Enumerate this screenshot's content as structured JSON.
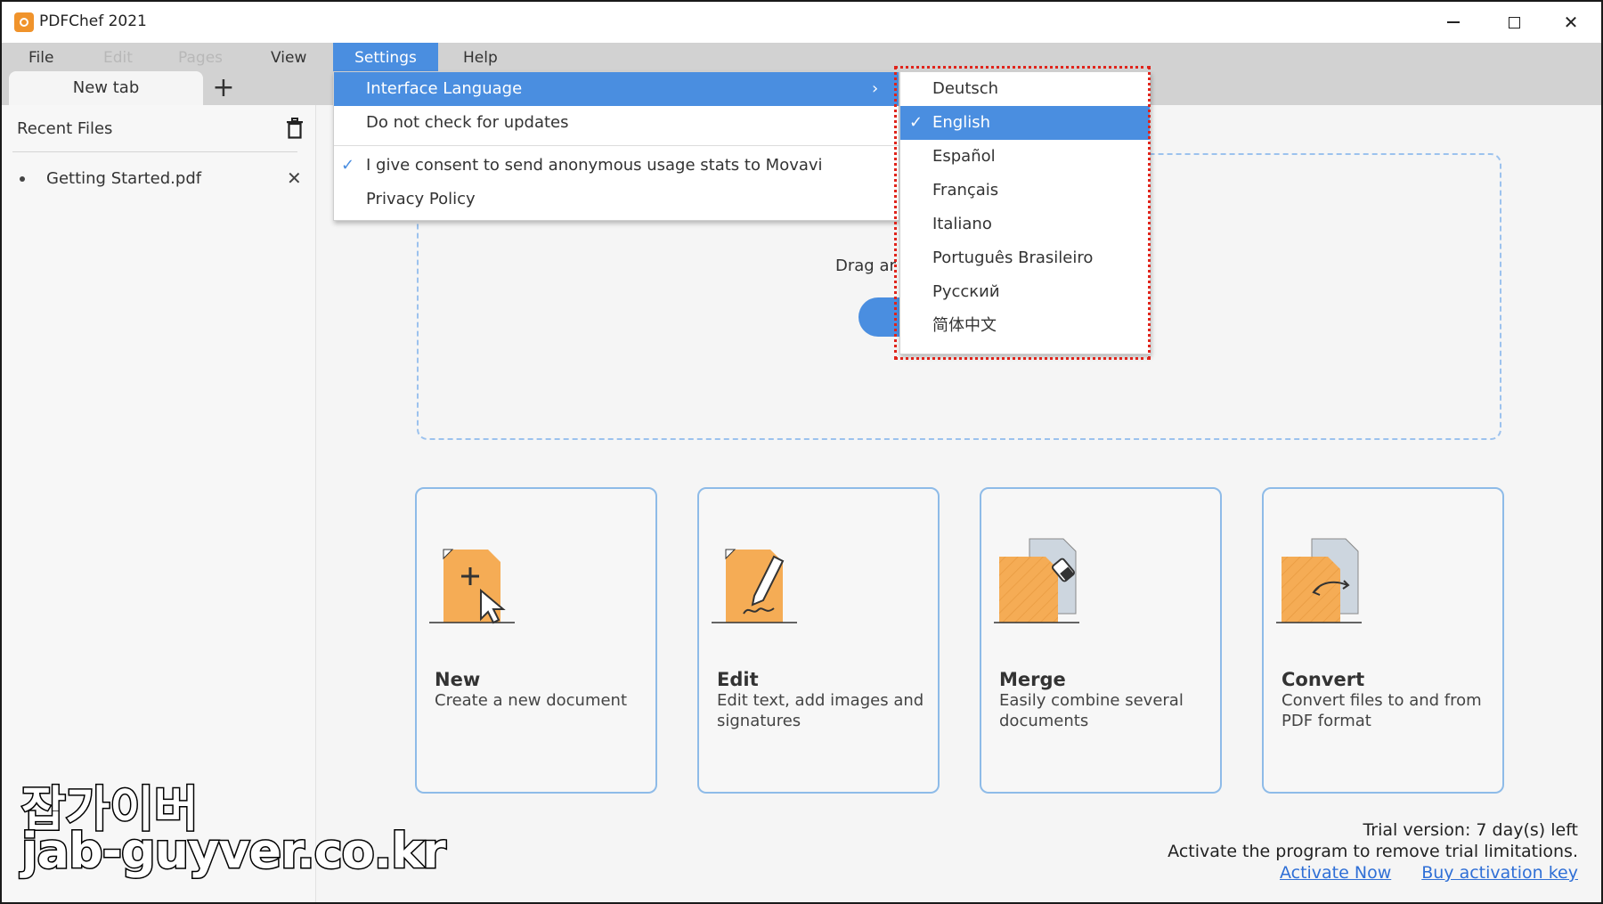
{
  "window": {
    "title": "PDFChef 2021"
  },
  "menu": {
    "file": "File",
    "edit": "Edit",
    "pages": "Pages",
    "view": "View",
    "settings": "Settings",
    "help": "Help"
  },
  "tabs": {
    "new_tab": "New tab",
    "add": "+"
  },
  "sidebar": {
    "title": "Recent Files",
    "files": [
      {
        "name": "Getting Started.pdf"
      }
    ]
  },
  "settings_menu": {
    "interface_language": "Interface Language",
    "no_updates": "Do not check for updates",
    "consent": "I give consent to send anonymous usage stats to Movavi",
    "privacy": "Privacy Policy"
  },
  "languages": [
    "Deutsch",
    "English",
    "Español",
    "Français",
    "Italiano",
    "Português Brasileiro",
    "Русский",
    "简体中文"
  ],
  "selected_language": "English",
  "drop": {
    "text": "Drag ar"
  },
  "cards": [
    {
      "title": "New",
      "desc": "Create a new document"
    },
    {
      "title": "Edit",
      "desc": "Edit text, add images and signatures"
    },
    {
      "title": "Merge",
      "desc": "Easily combine several documents"
    },
    {
      "title": "Convert",
      "desc": "Convert files to and from PDF format"
    }
  ],
  "trial": {
    "line1": "Trial version: 7 day(s) left",
    "line2": "Activate the program to remove trial limitations.",
    "activate": "Activate Now",
    "buy": "Buy activation key"
  },
  "watermark": {
    "korean": "잡가이버",
    "url": "jab-guyver.co.kr"
  },
  "colors": {
    "accent": "#4a8ee0",
    "orange": "#f5ac55",
    "highlight_box": "#e0241b"
  }
}
